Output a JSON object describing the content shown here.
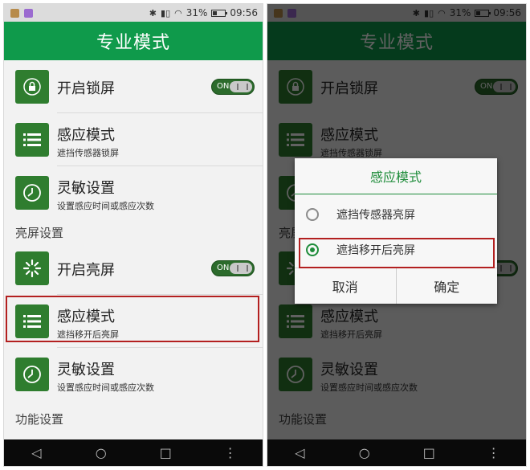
{
  "status": {
    "battery": "31%",
    "time": "09:56",
    "signal_icon": "signal-icon",
    "wifi_icon": "wifi-icon",
    "bluetooth_icon": "bluetooth-icon"
  },
  "title": "专业模式",
  "rows": {
    "lock": {
      "label": "开启锁屏",
      "toggle_label": "ON",
      "icon": "lock-icon"
    },
    "sense1": {
      "label": "感应模式",
      "sub": "遮挡传感器锁屏",
      "icon": "list-icon"
    },
    "sens1": {
      "label": "灵敏设置",
      "sub": "设置感应时间或感应次数",
      "icon": "clock-icon"
    },
    "section_bright": "亮屏设置",
    "wake": {
      "label": "开启亮屏",
      "toggle_label": "ON",
      "icon": "sun-icon"
    },
    "sense2": {
      "label": "感应模式",
      "sub": "遮挡移开后亮屏",
      "icon": "list-icon"
    },
    "sens2": {
      "label": "灵敏设置",
      "sub": "设置感应时间或感应次数",
      "icon": "clock-icon"
    },
    "section_func": "功能设置"
  },
  "dialog": {
    "title": "感应模式",
    "options": [
      {
        "label": "遮挡传感器亮屏",
        "selected": false
      },
      {
        "label": "遮挡移开后亮屏",
        "selected": true
      }
    ],
    "cancel": "取消",
    "confirm": "确定"
  },
  "colors": {
    "accent": "#0f9a4b",
    "icon_bg": "#2f7d2f",
    "highlight": "#b32020"
  },
  "nav": {
    "back": "◁",
    "home": "○",
    "recents": "□",
    "menu": "⋮"
  }
}
